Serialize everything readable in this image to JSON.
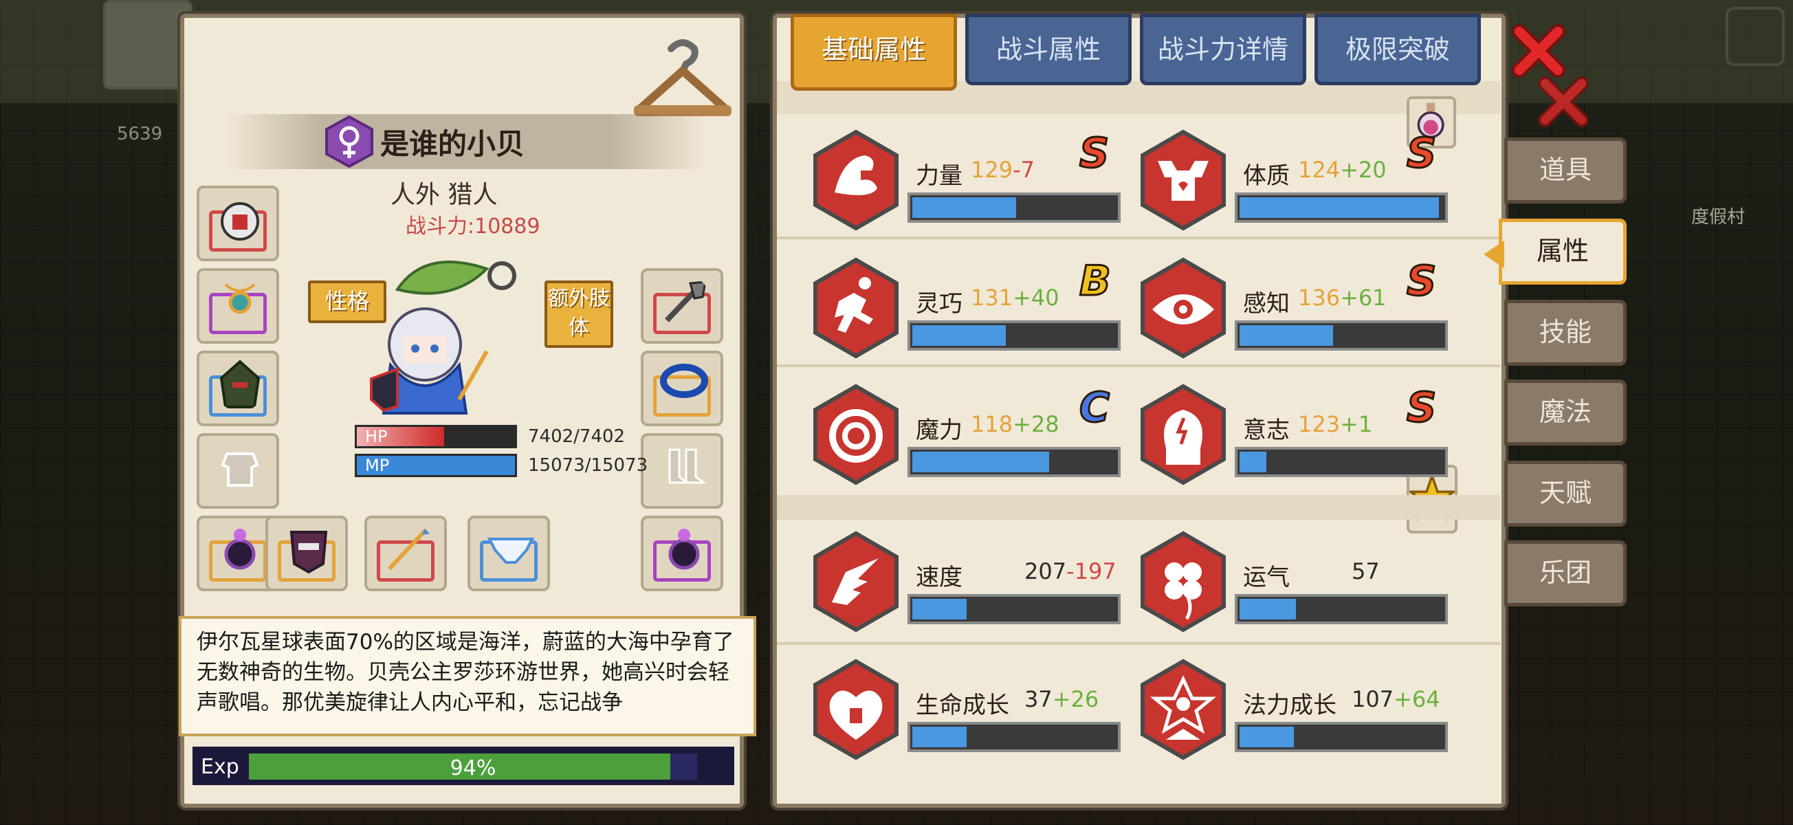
{
  "background": {
    "number": "5639",
    "village_label": "度假村"
  },
  "character": {
    "name": "是谁的小贝",
    "class": "人外 猎人",
    "power_label": "战斗力:",
    "power_value": "10889",
    "personality_button": "性格",
    "extra_limbs_button": "额外肢体",
    "hp": {
      "label": "HP",
      "value": "7402/7402",
      "fraction": 0.55
    },
    "mp": {
      "label": "MP",
      "value": "15073/15073",
      "fraction": 1.0
    },
    "description": "伊尔瓦星球表面70%的区域是海洋，蔚蓝的大海中孕育了无数神奇的生物。贝壳公主罗莎环游世界，她高兴时会轻声歌唱。那优美旋律让人内心平和，忘记战争",
    "exp": {
      "label": "Exp",
      "percent_text": "94%",
      "fraction": 0.94
    }
  },
  "tabs": [
    {
      "label": "基础属性",
      "active": true
    },
    {
      "label": "战斗属性",
      "active": false
    },
    {
      "label": "战斗力详情",
      "active": false
    },
    {
      "label": "极限突破",
      "active": false
    }
  ],
  "stats": {
    "strength": {
      "name": "力量",
      "base": "129",
      "mod": "-7",
      "grade": "S",
      "fill": 0.52
    },
    "constitution": {
      "name": "体质",
      "base": "124",
      "mod": "+20",
      "grade": "S",
      "fill": 0.98
    },
    "agility": {
      "name": "灵巧",
      "base": "131",
      "mod": "+40",
      "grade": "B",
      "fill": 0.47
    },
    "perception": {
      "name": "感知",
      "base": "136",
      "mod": "+61",
      "grade": "S",
      "fill": 0.47
    },
    "magic": {
      "name": "魔力",
      "base": "118",
      "mod": "+28",
      "grade": "C",
      "fill": 0.68
    },
    "will": {
      "name": "意志",
      "base": "123",
      "mod": "+1",
      "grade": "S",
      "fill": 0.15
    },
    "speed": {
      "name": "速度",
      "base": "207",
      "mod": "-197",
      "fill": 0.28
    },
    "luck": {
      "name": "运气",
      "base": "57",
      "mod": "",
      "fill": 0.29
    },
    "hp_growth": {
      "name": "生命成长",
      "base": "37",
      "mod": "+26",
      "fill": 0.28
    },
    "mp_growth": {
      "name": "法力成长",
      "base": "107",
      "mod": "+64",
      "fill": 0.28
    }
  },
  "side_menu": [
    {
      "label": "道具",
      "active": false
    },
    {
      "label": "属性",
      "active": true
    },
    {
      "label": "技能",
      "active": false
    },
    {
      "label": "魔法",
      "active": false
    },
    {
      "label": "天赋",
      "active": false
    },
    {
      "label": "乐团",
      "active": false
    }
  ],
  "colors": {
    "panel": "#f1e9d7",
    "tab_active": "#e6a531",
    "tab_inactive": "#4a6494",
    "hex_red": "#c8342e",
    "stat_bar": "#4a98e0",
    "grade_S": "#e8482c",
    "grade_B": "#f0c020",
    "grade_C": "#4a78e0"
  }
}
